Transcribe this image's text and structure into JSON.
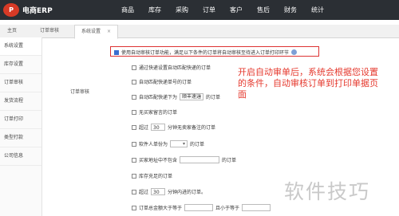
{
  "app": {
    "logo_letter": "P",
    "brand": "电商ERP"
  },
  "nav": [
    "商品",
    "库存",
    "采购",
    "订单",
    "客户",
    "售后",
    "财务",
    "统计"
  ],
  "tabs": {
    "home": "主页",
    "order_audit": "订单审核",
    "system_settings": "系统设置",
    "close": "×"
  },
  "sidebar": [
    "系统设置",
    "库存设置",
    "订单审核",
    "发货流程",
    "订单打印",
    "类型打款",
    "公司信息"
  ],
  "highlight_text": "使用自动审核订单功能，满足以下条件的订单将自动审核至待进入订单打印环节",
  "section_label": "订单审核",
  "options": [
    "通过快递设置自动匹配快递的订单",
    "自动匹配快递单号的订单",
    "自动匹配快递下为",
    "无买家留言的订单",
    "超过",
    "分钟无卖家备注的订单",
    "软件人单份为",
    "的订单",
    "买家地址中不包含",
    "的订单",
    "库存充足的订单",
    "超过",
    "分钟内进的订单。",
    "订单总金额大于等于",
    "且小于等于"
  ],
  "select_value": "顺丰速运",
  "num_1": "30",
  "num_2": "30",
  "annotation": "开启自动审单后，系统会根据您设置的条件，自动审核订单到打印单据页面",
  "watermark": "软件技巧"
}
